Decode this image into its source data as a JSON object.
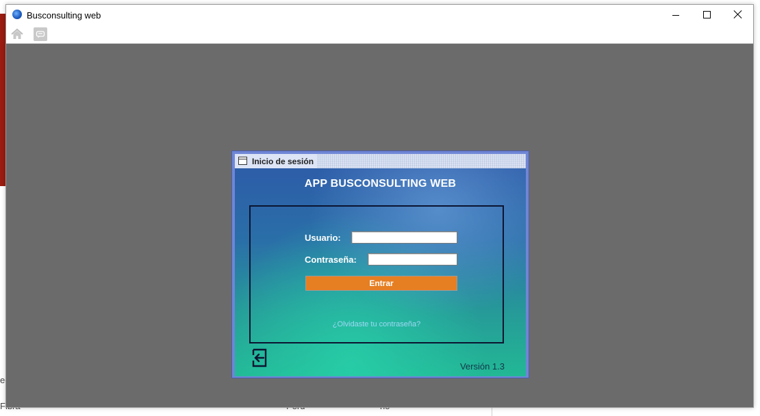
{
  "window": {
    "title": "Busconsulting web",
    "controls": {
      "minimize": "minimize",
      "maximize": "maximize",
      "close": "close"
    }
  },
  "toolbar": {
    "icons": [
      "home-icon",
      "chat-icon"
    ]
  },
  "background_app": {
    "text_left_1": "ec",
    "text_left_2": "Fibra",
    "text_mid": "Perú",
    "text_right": "no"
  },
  "login": {
    "frame_title": "Inicio de sesión",
    "heading": "APP BUSCONSULTING WEB",
    "user_label": "Usuario:",
    "user_value": "",
    "password_label": "Contraseña:",
    "password_value": "",
    "submit_label": "Entrar",
    "forgot_link": "¿Olvidaste tu contraseña?",
    "version": "Versión 1.3",
    "colors": {
      "frame_border": "#6f86d6",
      "button": "#e67e22",
      "link": "#9fd9f5"
    }
  }
}
